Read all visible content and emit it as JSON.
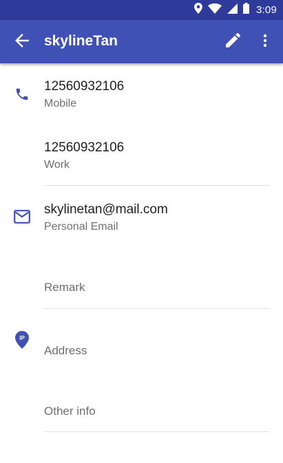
{
  "status_bar": {
    "time": "3:09",
    "icons": [
      "location-icon",
      "wifi-icon",
      "cell-signal-icon",
      "battery-icon"
    ]
  },
  "app_bar": {
    "title": "skylineTan",
    "back_icon": "arrow-back-icon",
    "edit_icon": "pencil-icon",
    "more_icon": "more-vertical-icon"
  },
  "contact": {
    "phones": [
      {
        "number": "12560932106",
        "type": "Mobile"
      },
      {
        "number": "12560932106",
        "type": "Work"
      }
    ],
    "email": {
      "address": "skylinetan@mail.com",
      "type": "Personal Email"
    },
    "remark_hint": "Remark",
    "address_hint": "Address",
    "other_info_hint": "Other info"
  },
  "colors": {
    "status_bar": "#2f3b9a",
    "app_bar": "#3f51b5",
    "accent_icon": "#3f51b5",
    "primary_text": "#212121",
    "secondary_text": "#6f6f6f",
    "divider": "#e0e0e0"
  }
}
